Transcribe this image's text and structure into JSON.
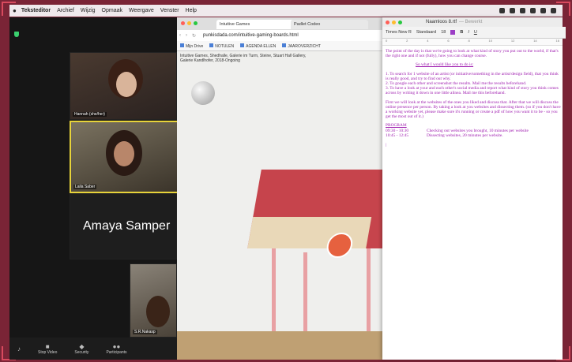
{
  "menubar": {
    "app": "Teksteditor",
    "items": [
      "Archief",
      "Wijzig",
      "Opmaak",
      "Weergave",
      "Venster",
      "Help"
    ]
  },
  "zoom": {
    "participants": [
      "Hannah (she/her)",
      "Laila Saber",
      "Amaya Samper",
      "S.R.Nakasp"
    ],
    "toolbar": [
      "Stop Video",
      "Security",
      "Participants"
    ]
  },
  "browser": {
    "tabs": [
      "Intuitive Games",
      "Padlet Codeo"
    ],
    "url": "punkisdada.com/intuitive-gaming-boards.html",
    "bookmarks": [
      "Mijn Drive",
      "NOTULEN",
      "AGENDA ELLEN",
      "JAAROVERZICHT"
    ],
    "caption": "Intuitive Games, Shedhalle, Galerie im Turm, Steine, Stuart Hall Gallery, Galerie Kandlhofer, 2018-Ongoing"
  },
  "textedit": {
    "title": "Naamloos 8.rtf",
    "subtitle": "— Bewerkt",
    "font": "Times New R",
    "style": "Standaard",
    "size": "18",
    "intro": "The point of the day is that we're going to look at what kind of story you put out to the world, if that's the right one and if not (fully), how you can change course.",
    "heading": "So what I would like you to do is:",
    "steps": [
      "1. To search for 1 website of an artist (or initiative/something in the artist/design field), that you think is really good, and try to find out why.",
      "2. To google each other and screenshot the results. Mail me the results beforehand.",
      "3. To have a look at your and each other's social media and report what kind of story you think comes across by writing it down in one little alinea. Mail me this beforehand."
    ],
    "after": "First we will look at the websites of the ones you liked and discuss that. After that we will discuss the online presence per person. By taking a look at you websites and dissecting them. (so if you don't have a working website yet, please make sure it's running or create a pdf of how you want it to be - so you get the most out of it.)",
    "program_label": "PROGRAM",
    "program": [
      {
        "time": "09:30 - 10:30",
        "text": "Checking out websites you brought, 10 minutes per website"
      },
      {
        "time": "10:45 - 12:45",
        "text": "Dissecting websites, 20 minutes per website."
      }
    ],
    "tail": "|"
  },
  "colors": {
    "text": "#a020b0",
    "frame": "#7a2436"
  }
}
